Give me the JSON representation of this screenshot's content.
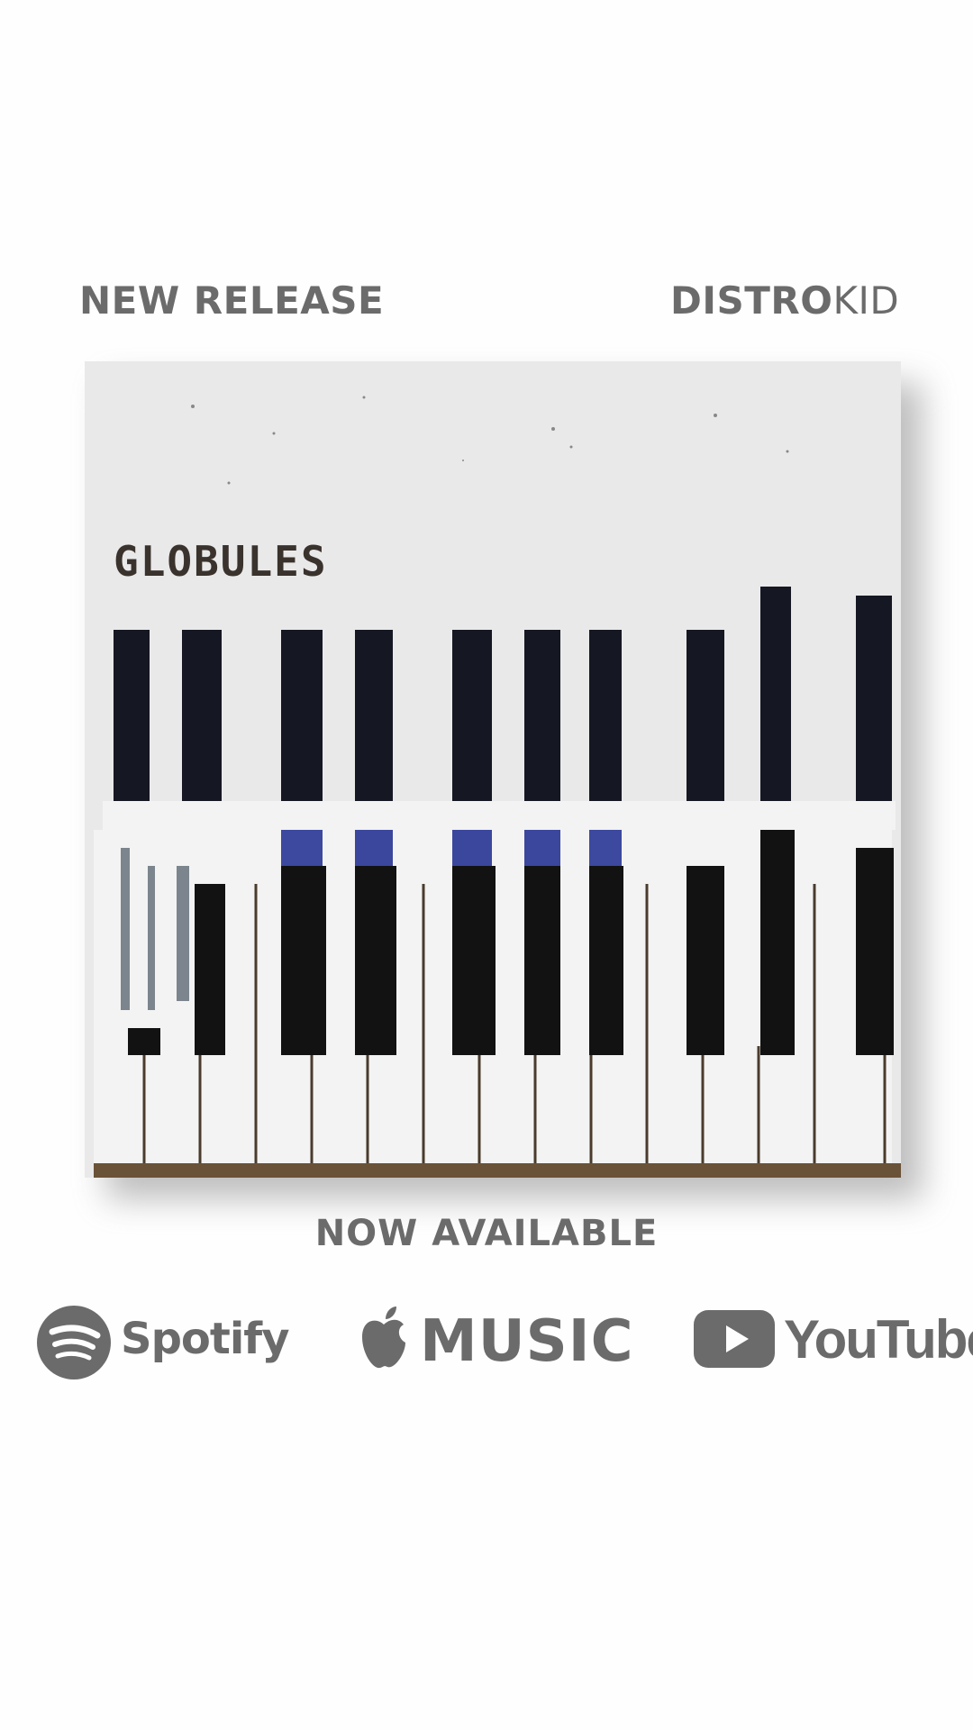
{
  "header": {
    "left_label": "NEW RELEASE",
    "brand_bold": "DISTRO",
    "brand_light": "KID"
  },
  "album": {
    "title": "GLOBULES"
  },
  "footer": {
    "now_available": "NOW AVAILABLE"
  },
  "platforms": {
    "spotify": "Spotify",
    "apple_music": "MUSIC",
    "youtube": "YouTube"
  },
  "colors": {
    "text_gray": "#6b6b6b",
    "cover_bg": "#e9e9ea",
    "key_black": "#151515",
    "key_blue": "#1b2a8f"
  }
}
